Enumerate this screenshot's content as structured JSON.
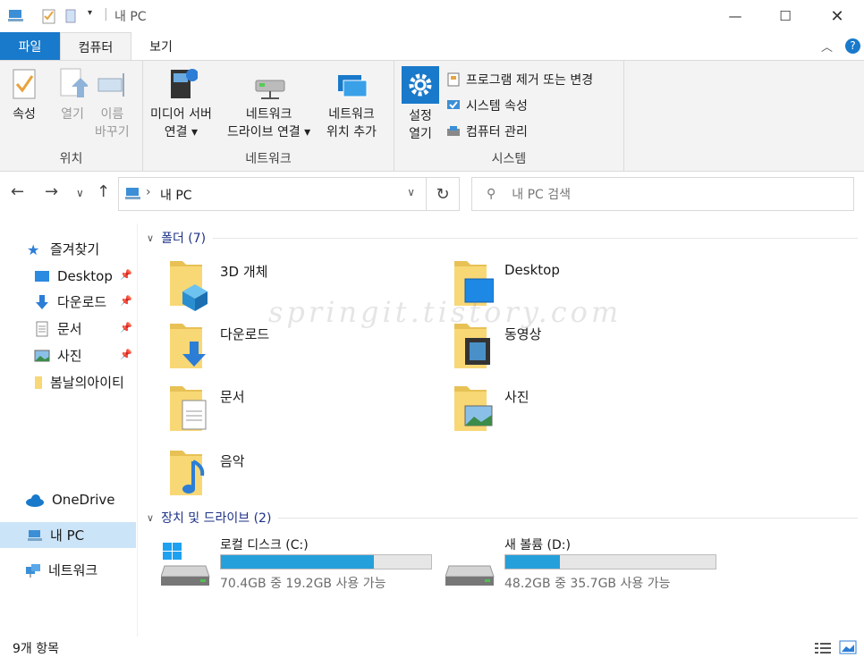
{
  "window": {
    "title": "내 PC"
  },
  "tabs": {
    "file": "파일",
    "computer": "컴퓨터",
    "view": "보기"
  },
  "ribbon": {
    "location": {
      "label": "위치",
      "properties": "속성",
      "open": "열기",
      "rename_1": "이름",
      "rename_2": "바꾸기"
    },
    "network": {
      "label": "네트워크",
      "media_1": "미디어 서버",
      "media_2": "연결",
      "map_1": "네트워크",
      "map_2": "드라이브 연결",
      "add_1": "네트워크",
      "add_2": "위치 추가"
    },
    "system": {
      "label": "시스템",
      "settings_1": "설정",
      "settings_2": "열기",
      "uninstall": "프로그램 제거 또는 변경",
      "sysprops": "시스템 속성",
      "manage": "컴퓨터 관리"
    }
  },
  "address": {
    "path": "내 PC",
    "search_placeholder": "내 PC 검색"
  },
  "sidebar": {
    "quick_access": "즐겨찾기",
    "items": [
      {
        "label": "Desktop",
        "pinned": true
      },
      {
        "label": "다운로드",
        "pinned": true
      },
      {
        "label": "문서",
        "pinned": true
      },
      {
        "label": "사진",
        "pinned": true
      },
      {
        "label": "봄날의아이티",
        "pinned": false
      }
    ],
    "onedrive": "OneDrive",
    "thispc": "내 PC",
    "network": "네트워크"
  },
  "sections": {
    "folders": "폴더 (7)",
    "drives": "장치 및 드라이브 (2)"
  },
  "folders": [
    {
      "label": "3D 개체",
      "icon": "3d-objects-icon"
    },
    {
      "label": "Desktop",
      "icon": "desktop-icon"
    },
    {
      "label": "다운로드",
      "icon": "downloads-icon"
    },
    {
      "label": "동영상",
      "icon": "videos-icon"
    },
    {
      "label": "문서",
      "icon": "documents-icon"
    },
    {
      "label": "사진",
      "icon": "pictures-icon"
    },
    {
      "label": "음악",
      "icon": "music-icon"
    }
  ],
  "drives": [
    {
      "label": "로컬 디스크 (C:)",
      "detail": "70.4GB 중 19.2GB 사용 가능",
      "used_fraction": 0.727
    },
    {
      "label": "새 볼륨 (D:)",
      "detail": "48.2GB 중 35.7GB 사용 가능",
      "used_fraction": 0.259
    }
  ],
  "status": {
    "count": "9개 항목"
  },
  "watermark": "springit.tistory.com",
  "colors": {
    "accent": "#1979ca",
    "bar": "#26a0da",
    "folder": "#f8d775"
  }
}
